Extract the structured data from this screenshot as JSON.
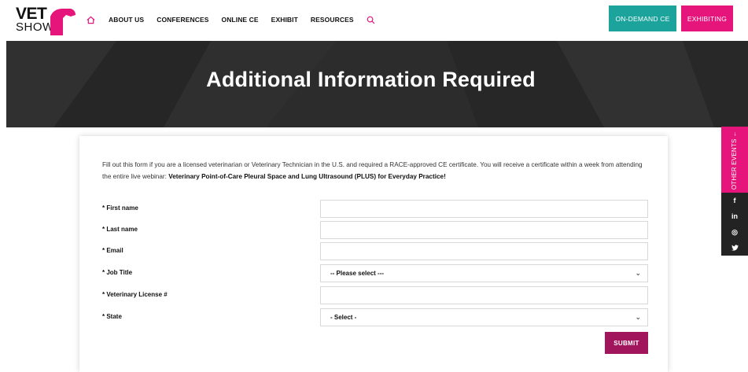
{
  "header": {
    "logo_line1": "VET",
    "logo_line2": "SHOW",
    "nav": [
      "ABOUT US",
      "CONFERENCES",
      "ONLINE CE",
      "EXHIBIT",
      "RESOURCES"
    ],
    "ondemand_label": "ON-DEMAND CE",
    "exhibiting_label": "EXHIBITING",
    "colors": {
      "teal": "#1ba39c",
      "pink": "#e5157c"
    }
  },
  "hero": {
    "title": "Additional Information Required"
  },
  "rail": {
    "events_label": "OTHER EVENTS ←",
    "social": [
      "f",
      "in",
      "◎",
      "🐦"
    ]
  },
  "form": {
    "intro_text": "Fill out this form if you are a licensed veterinarian or Veterinary Technician in the U.S. and required a RACE-approved CE certificate. You will receive a certificate within a week from attending the entire live webinar: ",
    "intro_bold": "Veterinary Point-of-Care Pleural Space and Lung Ultrasound (PLUS) for Everyday Practice!",
    "fields": [
      {
        "label": "* First name",
        "type": "text",
        "value": ""
      },
      {
        "label": "* Last name",
        "type": "text",
        "value": ""
      },
      {
        "label": "* Email",
        "type": "text",
        "value": ""
      },
      {
        "label": "* Job Title",
        "type": "select",
        "value": "-- Please select ---"
      },
      {
        "label": "* Veterinary License #",
        "type": "text",
        "value": ""
      },
      {
        "label": "* State",
        "type": "select",
        "value": "- Select -"
      }
    ],
    "submit_label": "SUBMIT",
    "submit_color": "#a0155b"
  }
}
